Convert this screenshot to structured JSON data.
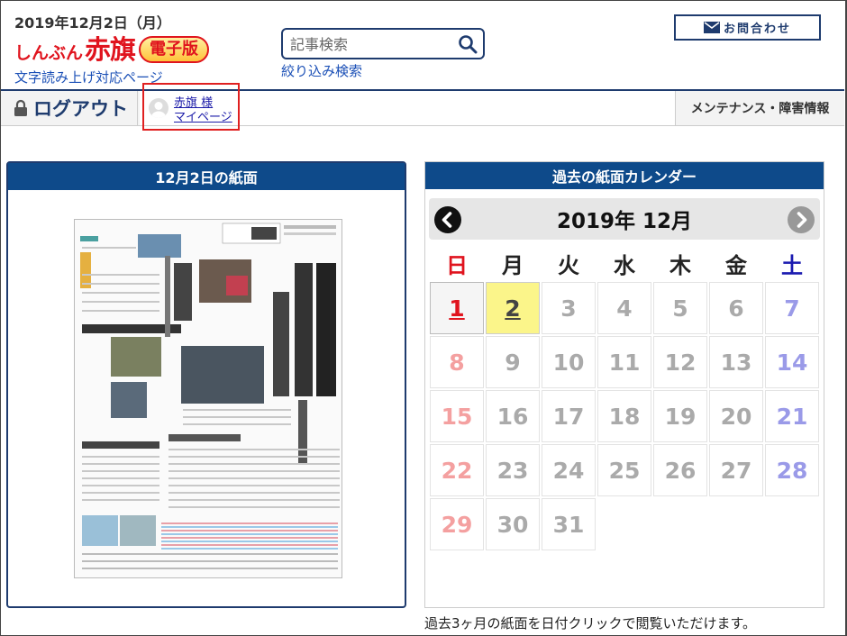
{
  "header": {
    "date": "2019年12月2日（月）",
    "logo_small": "しんぶん",
    "logo_big": "赤旗",
    "logo_badge": "電子版",
    "tts_link": "文字読み上げ対応ページ",
    "search_placeholder": "記事検索",
    "filter_link": "絞り込み検索",
    "contact": "お問合わせ"
  },
  "nav": {
    "logout": "ログアウト",
    "user_name": "赤旗 様",
    "my_page": "マイページ",
    "maintenance": "メンテナンス・障害情報"
  },
  "paper_panel": {
    "title": "12月2日の紙面"
  },
  "calendar": {
    "title": "過去の紙面カレンダー",
    "month_label": "2019年 12月",
    "weekdays": [
      "日",
      "月",
      "火",
      "水",
      "木",
      "金",
      "土"
    ],
    "days": [
      "1",
      "2",
      "3",
      "4",
      "5",
      "6",
      "7",
      "8",
      "9",
      "10",
      "11",
      "12",
      "13",
      "14",
      "15",
      "16",
      "17",
      "18",
      "19",
      "20",
      "21",
      "22",
      "23",
      "24",
      "25",
      "26",
      "27",
      "28",
      "29",
      "30",
      "31"
    ],
    "available_days": [
      "1",
      "2"
    ],
    "selected_day": "2",
    "note": "過去3ヶ月の紙面を日付クリックで閲覧いただけます。"
  },
  "colors": {
    "brand_red": "#e0141e",
    "navy": "#1e3b6e",
    "panel_head": "#0e4a8a",
    "selected_day_bg": "#fbf58a"
  }
}
